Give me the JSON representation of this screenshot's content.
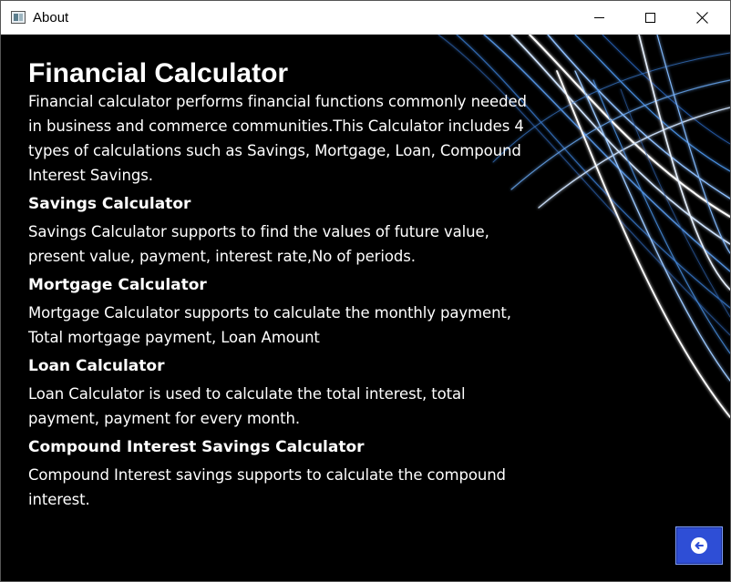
{
  "window": {
    "title": "About"
  },
  "content": {
    "heading": "Financial Calculator",
    "intro": "Financial calculator performs financial functions commonly needed in business and commerce communities.This Calculator includes 4 types of calculations such as Savings, Mortgage, Loan, Compound Interest Savings.",
    "sections": [
      {
        "title": "Savings Calculator",
        "text": "Savings Calculator supports to find the values of future value, present value, payment, interest rate,No of periods."
      },
      {
        "title": "Mortgage Calculator",
        "text": "Mortgage Calculator supports to calculate the monthly payment, Total mortgage payment, Loan Amount"
      },
      {
        "title": "Loan Calculator",
        "text": "Loan Calculator is used to calculate the total interest, total payment, payment for every month."
      },
      {
        "title": "Compound Interest Savings Calculator",
        "text": "Compound Interest savings supports to calculate the compound interest."
      }
    ]
  },
  "icons": {
    "back": "arrow-left-icon",
    "app": "app-window-icon"
  },
  "colors": {
    "background": "#000000",
    "text": "#ffffff",
    "back_button": "#2e4ed6",
    "swirl": "#4a8fe0"
  }
}
